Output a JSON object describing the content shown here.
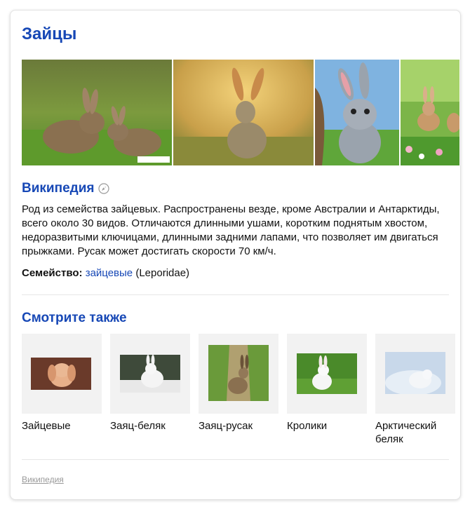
{
  "card": {
    "title": "Зайцы",
    "gallery": [
      {
        "name": "rabbits-pair-image",
        "badge": "MirKrolikov.ru"
      },
      {
        "name": "hare-sunset-image"
      },
      {
        "name": "cartoon-rabbit-image"
      },
      {
        "name": "rabbit-flowers-image"
      }
    ],
    "wiki": {
      "heading": "Википедия",
      "description": "Род из семейства зайцевых. Распространены везде, кроме Австралии и Антарктиды, всего около 30 видов. Отличаются длинными ушами, коротким поднятым хвостом, недоразвитыми ключицами, длинными задними лапами, что позволяет им двигаться прыжками. Русак может достигать скорости 70 км/ч.",
      "family_label": "Семейство:",
      "family_link": "зайцевые",
      "family_latin": "(Leporidae)"
    },
    "see_also": {
      "heading": "Смотрите также",
      "items": [
        {
          "label": "Зайцевые"
        },
        {
          "label": "Заяц-беляк"
        },
        {
          "label": "Заяц-русак"
        },
        {
          "label": "Кролики"
        },
        {
          "label": "Арктический беляк"
        }
      ]
    },
    "footer": {
      "source_link": "Википедия"
    }
  }
}
